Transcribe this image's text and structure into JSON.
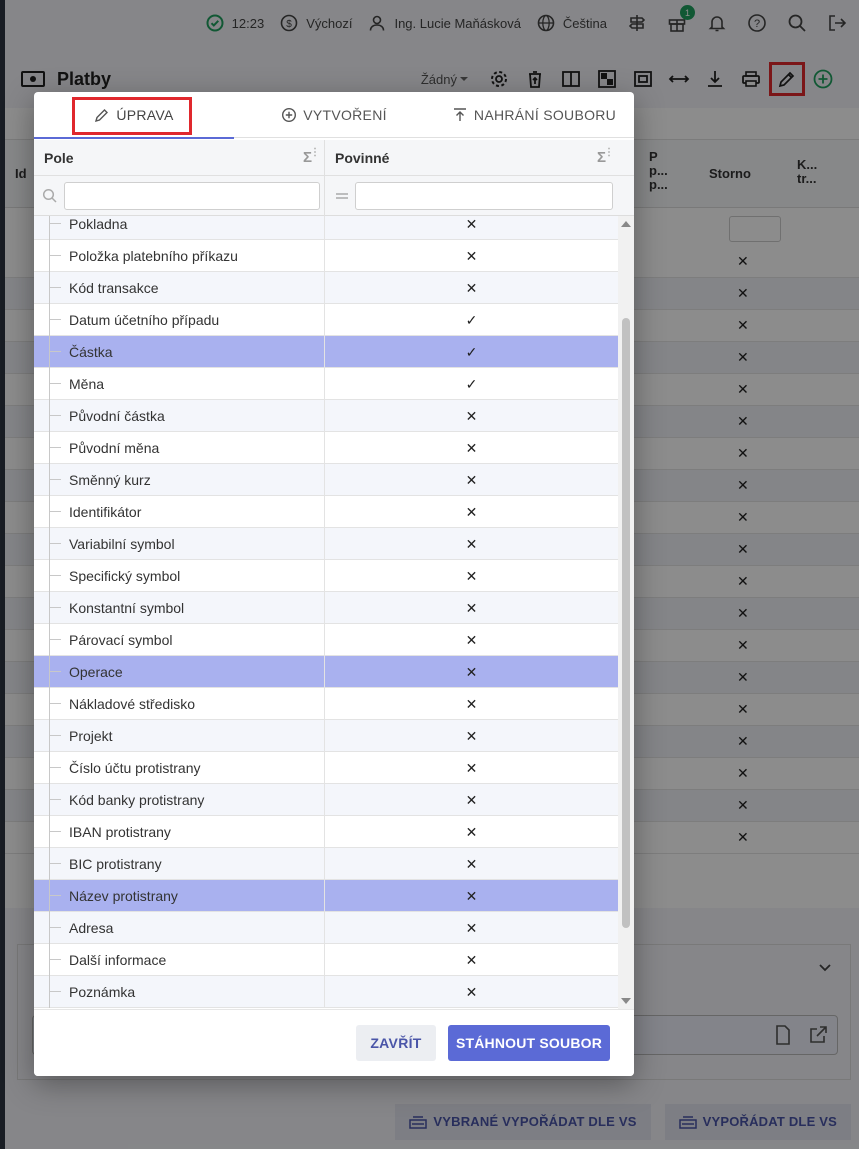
{
  "topbar": {
    "time": "12:23",
    "workspace": "Výchozí",
    "user": "Ing. Lucie Maňásková",
    "language": "Čeština",
    "notification_count": "1"
  },
  "page": {
    "title": "Platby",
    "filter_select": "Žádný"
  },
  "background_grid": {
    "col_id": "Id",
    "col_p": "P p... p...",
    "col_storno": "Storno",
    "col_k": "K... tr..."
  },
  "footer_buttons": {
    "settle_selected": "VYBRANÉ VYPOŘÁDAT DLE VS",
    "settle": "VYPOŘÁDAT DLE VS"
  },
  "modal": {
    "tabs": [
      {
        "label": "ÚPRAVA",
        "icon": "pencil-icon"
      },
      {
        "label": "VYTVOŘENÍ",
        "icon": "plus-circle-icon"
      },
      {
        "label": "NAHRÁNÍ SOUBORU",
        "icon": "upload-icon"
      }
    ],
    "columns": {
      "field": "Pole",
      "required": "Povinné"
    },
    "filter": {
      "field_value": "",
      "required_value": ""
    },
    "rows": [
      {
        "field": "Pokladna",
        "required": "✕",
        "selected": false
      },
      {
        "field": "Položka platebního příkazu",
        "required": "✕",
        "selected": false
      },
      {
        "field": "Kód transakce",
        "required": "✕",
        "selected": false
      },
      {
        "field": "Datum účetního případu",
        "required": "✓",
        "selected": false
      },
      {
        "field": "Částka",
        "required": "✓",
        "selected": true
      },
      {
        "field": "Měna",
        "required": "✓",
        "selected": false
      },
      {
        "field": "Původní částka",
        "required": "✕",
        "selected": false
      },
      {
        "field": "Původní měna",
        "required": "✕",
        "selected": false
      },
      {
        "field": "Směnný kurz",
        "required": "✕",
        "selected": false
      },
      {
        "field": "Identifikátor",
        "required": "✕",
        "selected": false
      },
      {
        "field": "Variabilní symbol",
        "required": "✕",
        "selected": false
      },
      {
        "field": "Specifický symbol",
        "required": "✕",
        "selected": false
      },
      {
        "field": "Konstantní symbol",
        "required": "✕",
        "selected": false
      },
      {
        "field": "Párovací symbol",
        "required": "✕",
        "selected": false
      },
      {
        "field": "Operace",
        "required": "✕",
        "selected": true
      },
      {
        "field": "Nákladové středisko",
        "required": "✕",
        "selected": false
      },
      {
        "field": "Projekt",
        "required": "✕",
        "selected": false
      },
      {
        "field": "Číslo účtu protistrany",
        "required": "✕",
        "selected": false
      },
      {
        "field": "Kód banky protistrany",
        "required": "✕",
        "selected": false
      },
      {
        "field": "IBAN protistrany",
        "required": "✕",
        "selected": false
      },
      {
        "field": "BIC protistrany",
        "required": "✕",
        "selected": false
      },
      {
        "field": "Název protistrany",
        "required": "✕",
        "selected": true
      },
      {
        "field": "Adresa",
        "required": "✕",
        "selected": false
      },
      {
        "field": "Další informace",
        "required": "✕",
        "selected": false
      },
      {
        "field": "Poznámka",
        "required": "✕",
        "selected": false
      }
    ],
    "buttons": {
      "close": "ZAVŘÍT",
      "download": "STÁHNOUT SOUBOR"
    }
  }
}
